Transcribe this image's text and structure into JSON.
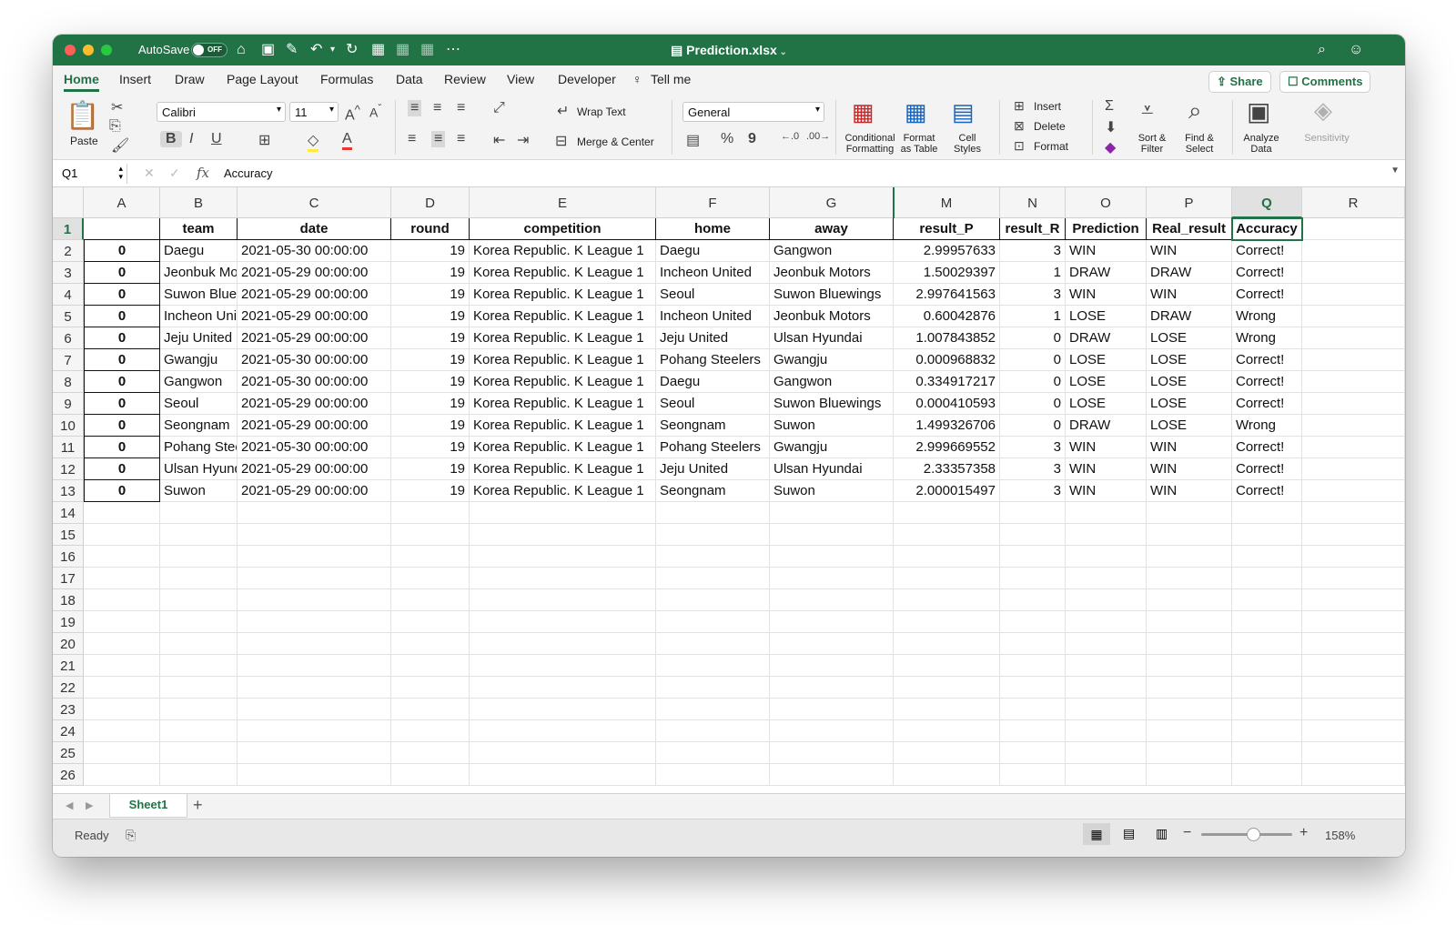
{
  "titlebar": {
    "autosave_label": "AutoSave",
    "autosave_state": "OFF",
    "document_title": "Prediction.xlsx",
    "colors": {
      "bar": "#217346"
    }
  },
  "menu": {
    "tabs": [
      "Home",
      "Insert",
      "Draw",
      "Page Layout",
      "Formulas",
      "Data",
      "Review",
      "View",
      "Developer",
      "Tell me"
    ],
    "active": "Home",
    "share_label": "Share",
    "comments_label": "Comments"
  },
  "ribbon": {
    "paste_label": "Paste",
    "font_name": "Calibri",
    "font_size": "11",
    "wrap_text_label": "Wrap Text",
    "merge_center_label": "Merge & Center",
    "number_format": "General",
    "conditional_formatting_label": "Conditional Formatting",
    "format_as_table_label": "Format as Table",
    "cell_styles_label": "Cell Styles",
    "insert_label": "Insert",
    "delete_label": "Delete",
    "format_label": "Format",
    "sort_filter_label": "Sort & Filter",
    "find_select_label": "Find & Select",
    "analyze_data_label": "Analyze Data",
    "sensitivity_label": "Sensitivity"
  },
  "formula_bar": {
    "name_box": "Q1",
    "fx": "fx",
    "value": "Accuracy"
  },
  "grid": {
    "column_letters": [
      "A",
      "B",
      "C",
      "D",
      "E",
      "F",
      "G",
      "M",
      "N",
      "O",
      "P",
      "Q",
      "R"
    ],
    "selected_column": "Q",
    "row_numbers": [
      "1",
      "2",
      "3",
      "4",
      "5",
      "6",
      "7",
      "8",
      "9",
      "10",
      "11",
      "12",
      "13",
      "14",
      "15",
      "16",
      "17",
      "18",
      "19",
      "20",
      "21",
      "22",
      "23",
      "24",
      "25",
      "26"
    ],
    "headers": [
      "",
      "team",
      "date",
      "round",
      "competition",
      "home",
      "away",
      "result_P",
      "result_R",
      "Prediction",
      "Real_result",
      "Accuracy"
    ],
    "rows": [
      [
        "0",
        "Daegu",
        "2021-05-30 00:00:00",
        "19",
        "Korea Republic. K League 1",
        "Daegu",
        "Gangwon",
        "2.99957633",
        "3",
        "WIN",
        "WIN",
        "Correct!"
      ],
      [
        "0",
        "Jeonbuk Motors",
        "2021-05-29 00:00:00",
        "19",
        "Korea Republic. K League 1",
        "Incheon United",
        "Jeonbuk Motors",
        "1.50029397",
        "1",
        "DRAW",
        "DRAW",
        "Correct!"
      ],
      [
        "0",
        "Suwon Bluewings",
        "2021-05-29 00:00:00",
        "19",
        "Korea Republic. K League 1",
        "Seoul",
        "Suwon Bluewings",
        "2.997641563",
        "3",
        "WIN",
        "WIN",
        "Correct!"
      ],
      [
        "0",
        "Incheon United",
        "2021-05-29 00:00:00",
        "19",
        "Korea Republic. K League 1",
        "Incheon United",
        "Jeonbuk Motors",
        "0.60042876",
        "1",
        "LOSE",
        "DRAW",
        "Wrong"
      ],
      [
        "0",
        "Jeju United",
        "2021-05-29 00:00:00",
        "19",
        "Korea Republic. K League 1",
        "Jeju United",
        "Ulsan Hyundai",
        "1.007843852",
        "0",
        "DRAW",
        "LOSE",
        "Wrong"
      ],
      [
        "0",
        "Gwangju",
        "2021-05-30 00:00:00",
        "19",
        "Korea Republic. K League 1",
        "Pohang Steelers",
        "Gwangju",
        "0.000968832",
        "0",
        "LOSE",
        "LOSE",
        "Correct!"
      ],
      [
        "0",
        "Gangwon",
        "2021-05-30 00:00:00",
        "19",
        "Korea Republic. K League 1",
        "Daegu",
        "Gangwon",
        "0.334917217",
        "0",
        "LOSE",
        "LOSE",
        "Correct!"
      ],
      [
        "0",
        "Seoul",
        "2021-05-29 00:00:00",
        "19",
        "Korea Republic. K League 1",
        "Seoul",
        "Suwon Bluewings",
        "0.000410593",
        "0",
        "LOSE",
        "LOSE",
        "Correct!"
      ],
      [
        "0",
        "Seongnam",
        "2021-05-29 00:00:00",
        "19",
        "Korea Republic. K League 1",
        "Seongnam",
        "Suwon",
        "1.499326706",
        "0",
        "DRAW",
        "LOSE",
        "Wrong"
      ],
      [
        "0",
        "Pohang Steelers",
        "2021-05-30 00:00:00",
        "19",
        "Korea Republic. K League 1",
        "Pohang Steelers",
        "Gwangju",
        "2.999669552",
        "3",
        "WIN",
        "WIN",
        "Correct!"
      ],
      [
        "0",
        "Ulsan Hyundai",
        "2021-05-29 00:00:00",
        "19",
        "Korea Republic. K League 1",
        "Jeju United",
        "Ulsan Hyundai",
        "2.33357358",
        "3",
        "WIN",
        "WIN",
        "Correct!"
      ],
      [
        "0",
        "Suwon",
        "2021-05-29 00:00:00",
        "19",
        "Korea Republic. K League 1",
        "Seongnam",
        "Suwon",
        "2.000015497",
        "3",
        "WIN",
        "WIN",
        "Correct!"
      ]
    ]
  },
  "sheets": {
    "tabs": [
      "Sheet1"
    ],
    "add_label": "+"
  },
  "status": {
    "ready": "Ready",
    "zoom": "158%"
  }
}
